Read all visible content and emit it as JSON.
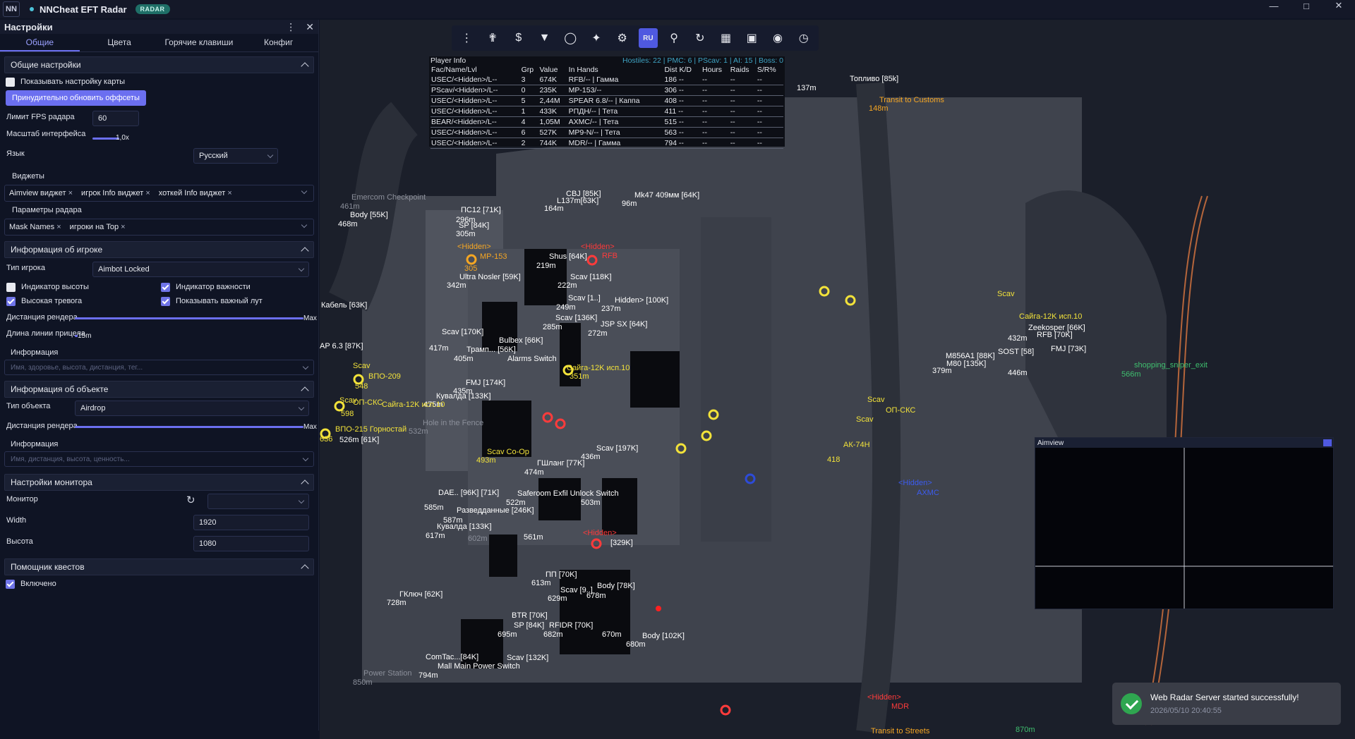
{
  "titlebar": {
    "logo": "NN",
    "title": "NNCheat EFT Radar",
    "badge": "RADAR"
  },
  "panel": {
    "title": "Настройки",
    "tabs": [
      "Общие",
      "Цвета",
      "Горячие клавиши",
      "Конфиг"
    ],
    "general": {
      "header": "Общие настройки",
      "show_map_setup": "Показывать настройку карты",
      "refresh_offsets": "Принудительно обновить оффсеты",
      "fps_label": "Лимит FPS радара",
      "fps_value": "60",
      "scale_label": "Масштаб интерфейса",
      "scale_value": "1,0x",
      "lang_label": "Язык",
      "lang_value": "Русский",
      "widgets_label": "Виджеты",
      "widgets": [
        "Aimview виджет",
        "игрок Info виджет",
        "хоткей Info виджет"
      ],
      "radar_params_label": "Параметры радара",
      "radar_params": [
        "Mask Names",
        "игроки на Top"
      ]
    },
    "player": {
      "header": "Информация об игроке",
      "type_label": "Тип игрока",
      "type_value": "Aimbot Locked",
      "height_ind": "Индикатор высоты",
      "importance_ind": "Индикатор важности",
      "high_alert": "Высокая тревога",
      "show_loot": "Показывать важный лут",
      "render_dist_label": "Дистанция рендера",
      "render_dist_value": "Max",
      "aim_line_label": "Длина линии прицела",
      "aim_line_value": "15m",
      "info_label": "Информация",
      "info_placeholder": "Имя, здоровье, высота, дистанция, тег..."
    },
    "object": {
      "header": "Информация об объекте",
      "type_label": "Тип объекта",
      "type_value": "Airdrop",
      "render_dist_label": "Дистанция рендера",
      "render_dist_value": "Max",
      "info_label": "Информация",
      "info_placeholder": "Имя, дистанция, высота, ценность..."
    },
    "monitor": {
      "header": "Настройки монитора",
      "monitor_label": "Монитор",
      "width_label": "Width",
      "width_value": "1920",
      "height_label": "Высота",
      "height_value": "1080"
    },
    "quest": {
      "header": "Помощник квестов",
      "enabled": "Включено"
    }
  },
  "toolbar": {
    "lang": "RU"
  },
  "player_info": {
    "title": "Player Info",
    "hostiles": "Hostiles: 22 | PMC: 6 | PScav: 1 | AI: 15 | Boss: 0",
    "columns": [
      "Fac/Name/Lvl",
      "Grp",
      "Value",
      "In Hands",
      "Dist K/D",
      "Hours",
      "Raids",
      "S/R%"
    ],
    "rows": [
      [
        "USEC/<Hidden>/L--",
        "3",
        "674K",
        "RFB/-- | Гамма",
        "186 --",
        "--",
        "--",
        "--"
      ],
      [
        "PScav/<Hidden>/L--",
        "0",
        "235K",
        "MP-153/--",
        "306 --",
        "--",
        "--",
        "--"
      ],
      [
        "USEC/<Hidden>/L--",
        "5",
        "2,44M",
        "SPEAR 6.8/-- | Каппа",
        "408 --",
        "--",
        "--",
        "--"
      ],
      [
        "USEC/<Hidden>/L--",
        "1",
        "433K",
        "РПДН/-- | Тета",
        "411 --",
        "--",
        "--",
        "--"
      ],
      [
        "BEAR/<Hidden>/L--",
        "4",
        "1,05M",
        "AXMC/-- | Тета",
        "515 --",
        "--",
        "--",
        "--"
      ],
      [
        "USEC/<Hidden>/L--",
        "6",
        "527K",
        "MP9-N/-- | Тета",
        "563 --",
        "--",
        "--",
        "--"
      ],
      [
        "USEC/<Hidden>/L--",
        "2",
        "744K",
        "MDR/-- | Гамма",
        "794 --",
        "--",
        "--",
        "--"
      ]
    ]
  },
  "map": {
    "labels": [
      {
        "t": "Топливо [85k]",
        "c": "w"
      },
      {
        "t": "137m",
        "c": "w"
      },
      {
        "t": "Transit to Customs",
        "c": "o"
      },
      {
        "t": "148m",
        "c": "o"
      },
      {
        "t": "Emercom Checkpoint",
        "c": "gray"
      },
      {
        "t": "461m",
        "c": "gray"
      },
      {
        "t": "Body [55K]",
        "c": "w"
      },
      {
        "t": "468m",
        "c": "w"
      },
      {
        "t": "ПС12 [71K]",
        "c": "w"
      },
      {
        "t": "296m",
        "c": "w"
      },
      {
        "t": "SP [84K]",
        "c": "w"
      },
      {
        "t": "305m",
        "c": "w"
      },
      {
        "t": "CBJ [85K]",
        "c": "w"
      },
      {
        "t": "164m",
        "c": "w"
      },
      {
        "t": "L137m[63K]",
        "c": "w"
      },
      {
        "t": "Mk47 409мм [64K]",
        "c": "w"
      },
      {
        "t": "96m",
        "c": "w"
      },
      {
        "t": "<Hidden>",
        "c": "o"
      },
      {
        "t": "MP-153",
        "c": "o"
      },
      {
        "t": "305",
        "c": "o"
      },
      {
        "t": "Shus [64K]",
        "c": "w"
      },
      {
        "t": "219m",
        "c": "w"
      },
      {
        "t": "<Hidden>",
        "c": "r"
      },
      {
        "t": "RFB",
        "c": "r"
      },
      {
        "t": "Ultra Nosler [59K]",
        "c": "w"
      },
      {
        "t": "342m",
        "c": "w"
      },
      {
        "t": "Scav [118K]",
        "c": "w"
      },
      {
        "t": "222m",
        "c": "w"
      },
      {
        "t": "Кабель [63K]",
        "c": "w"
      },
      {
        "t": "Scav [1..]",
        "c": "w"
      },
      {
        "t": "249m",
        "c": "w"
      },
      {
        "t": "Hidden> [100K]",
        "c": "w"
      },
      {
        "t": "237m",
        "c": "w"
      },
      {
        "t": "Scav [136K]",
        "c": "w"
      },
      {
        "t": "285m",
        "c": "w"
      },
      {
        "t": "JSP SX [64K]",
        "c": "w"
      },
      {
        "t": "272m",
        "c": "w"
      },
      {
        "t": "Scav [170K]",
        "c": "w"
      },
      {
        "t": "417m",
        "c": "w"
      },
      {
        "t": "Bulbex [66K]",
        "c": "w"
      },
      {
        "t": "Трамп... [56K]",
        "c": "w"
      },
      {
        "t": "405m",
        "c": "w"
      },
      {
        "t": "AP 6.3 [87K]",
        "c": "w"
      },
      {
        "t": "Alarms Switch",
        "c": "w"
      },
      {
        "t": "Scav",
        "c": "y"
      },
      {
        "t": "ВПО-209",
        "c": "y"
      },
      {
        "t": "548",
        "c": "y"
      },
      {
        "t": "FMJ [174K]",
        "c": "w"
      },
      {
        "t": "435m",
        "c": "w"
      },
      {
        "t": "Кувалда [133K]",
        "c": "w"
      },
      {
        "t": "475m",
        "c": "w"
      },
      {
        "t": "Scav",
        "c": "y"
      },
      {
        "t": "ОП-СКС",
        "c": "y"
      },
      {
        "t": "Сайга-12K исп.10",
        "c": "y"
      },
      {
        "t": "598",
        "c": "y"
      },
      {
        "t": "ВПО-215 Горностай",
        "c": "y"
      },
      {
        "t": "636",
        "c": "y"
      },
      {
        "t": "526m [61K]",
        "c": "w"
      },
      {
        "t": "Hole in the Fence",
        "c": "gray"
      },
      {
        "t": "532m",
        "c": "gray"
      },
      {
        "t": "Сайга-12K исп.10",
        "c": "y"
      },
      {
        "t": "351m",
        "c": "y"
      },
      {
        "t": "Scav [197K]",
        "c": "w"
      },
      {
        "t": "436m",
        "c": "w"
      },
      {
        "t": "Scav Co-Op",
        "c": "y"
      },
      {
        "t": "493m",
        "c": "y"
      },
      {
        "t": "ГШланг [77K]",
        "c": "w"
      },
      {
        "t": "474m",
        "c": "w"
      },
      {
        "t": "Saferoom Exfil Unlock Switch",
        "c": "w"
      },
      {
        "t": "522m",
        "c": "w"
      },
      {
        "t": "503m",
        "c": "w"
      },
      {
        "t": "DAE.. [96K] [71K]",
        "c": "w"
      },
      {
        "t": "585m",
        "c": "w"
      },
      {
        "t": "Разведданные [246K]",
        "c": "w"
      },
      {
        "t": "587m",
        "c": "w"
      },
      {
        "t": "Кувалда [133K]",
        "c": "w"
      },
      {
        "t": "617m",
        "c": "w"
      },
      {
        "t": "602m",
        "c": "gray"
      },
      {
        "t": "561m",
        "c": "w"
      },
      {
        "t": "<Hidden>",
        "c": "r"
      },
      {
        "t": "[329K]",
        "c": "w"
      },
      {
        "t": "ПП [70K]",
        "c": "w"
      },
      {
        "t": "613m",
        "c": "w"
      },
      {
        "t": "ГКлюч [62K]",
        "c": "w"
      },
      {
        "t": "728m",
        "c": "w"
      },
      {
        "t": "Scav [9..]",
        "c": "w"
      },
      {
        "t": "629m",
        "c": "w"
      },
      {
        "t": "Body [78K]",
        "c": "w"
      },
      {
        "t": "678m",
        "c": "w"
      },
      {
        "t": "BTR [70K]",
        "c": "w"
      },
      {
        "t": "SP [84K]",
        "c": "w"
      },
      {
        "t": "RFIDR [70K]",
        "c": "w"
      },
      {
        "t": "695m",
        "c": "w"
      },
      {
        "t": "682m",
        "c": "w"
      },
      {
        "t": "670m",
        "c": "w"
      },
      {
        "t": "Body [102K]",
        "c": "w"
      },
      {
        "t": "680m",
        "c": "w"
      },
      {
        "t": "ComTac...[84K]",
        "c": "w"
      },
      {
        "t": "Mall Main Power Switch",
        "c": "w"
      },
      {
        "t": "Scav [132K]",
        "c": "w"
      },
      {
        "t": "794m",
        "c": "w"
      },
      {
        "t": "Power Station",
        "c": "gray"
      },
      {
        "t": "850m",
        "c": "gray"
      },
      {
        "t": "<Hidden>",
        "c": "r"
      },
      {
        "t": "MDR",
        "c": "r"
      },
      {
        "t": "Transit to Streets",
        "c": "o"
      },
      {
        "t": "870m",
        "c": "g"
      },
      {
        "t": "Scav",
        "c": "y"
      },
      {
        "t": "ОП-СКС",
        "c": "y"
      },
      {
        "t": "Scav",
        "c": "y"
      },
      {
        "t": "АК-74Н",
        "c": "y"
      },
      {
        "t": "418",
        "c": "y"
      },
      {
        "t": "<Hidden>",
        "c": "b"
      },
      {
        "t": "AXMC",
        "c": "b"
      },
      {
        "t": "Scav",
        "c": "y"
      },
      {
        "t": "Сайга-12K исп.10",
        "c": "y"
      },
      {
        "t": "432m",
        "c": "w"
      },
      {
        "t": "Zeekosper [66K]",
        "c": "w"
      },
      {
        "t": "M856A1 [88K]",
        "c": "w"
      },
      {
        "t": "M80 [135K]",
        "c": "w"
      },
      {
        "t": "SOST [58]",
        "c": "w"
      },
      {
        "t": "FMJ [73K]",
        "c": "w"
      },
      {
        "t": "379m",
        "c": "w"
      },
      {
        "t": "446m",
        "c": "w"
      },
      {
        "t": "shopping_sniper_exit",
        "c": "g"
      },
      {
        "t": "566m",
        "c": "g"
      },
      {
        "t": "RFB [70K]",
        "c": "w"
      }
    ]
  },
  "aimview": {
    "title": "Aimview"
  },
  "toast": {
    "message": "Web Radar Server started successfully!",
    "timestamp": "2026/05/10 20:40:55"
  },
  "colors": {
    "accent": "#6b6ff0",
    "scav": "#f2e23a",
    "enemy": "#ff3b3b",
    "teammate": "#2d4bd8",
    "exit": "#3fbf6f",
    "transit": "#f5a623"
  }
}
